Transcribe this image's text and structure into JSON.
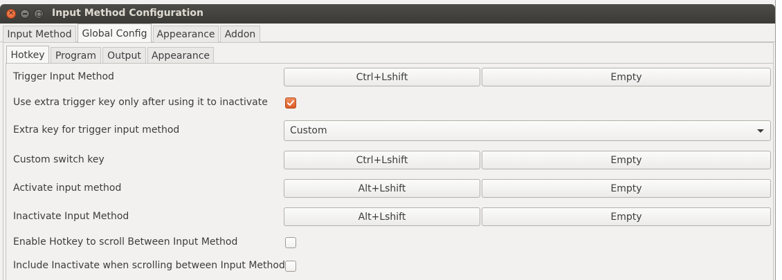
{
  "window": {
    "title": "Input Method Configuration"
  },
  "top_tabs": [
    {
      "label": "Input Method",
      "active": false
    },
    {
      "label": "Global Config",
      "active": true
    },
    {
      "label": "Appearance",
      "active": false
    },
    {
      "label": "Addon",
      "active": false
    }
  ],
  "sub_tabs": [
    {
      "label": "Hotkey",
      "active": true
    },
    {
      "label": "Program",
      "active": false
    },
    {
      "label": "Output",
      "active": false
    },
    {
      "label": "Appearance",
      "active": false
    }
  ],
  "hotkey": {
    "trigger_input_method": {
      "label": "Trigger Input Method",
      "key1": "Ctrl+Lshift",
      "key2": "Empty"
    },
    "extra_trigger_only_after": {
      "label": "Use extra trigger key only after using it to inactivate",
      "checked": true
    },
    "extra_key": {
      "label": "Extra key for trigger input method",
      "value": "Custom"
    },
    "custom_switch_key": {
      "label": "Custom switch key",
      "key1": "Ctrl+Lshift",
      "key2": "Empty"
    },
    "activate_input_method": {
      "label": "Activate input method",
      "key1": "Alt+Lshift",
      "key2": "Empty"
    },
    "inactivate_input_method": {
      "label": "Inactivate Input Method",
      "key1": "Alt+Lshift",
      "key2": "Empty"
    },
    "enable_scroll_hotkey": {
      "label": "Enable Hotkey to scroll Between Input Method",
      "checked": false
    },
    "include_inactivate_scrolling": {
      "label": "Include Inactivate when scrolling between Input Method",
      "checked": false
    }
  },
  "colors": {
    "accent_checkbox": "#dd5a23",
    "titlebar": "#3b3a36",
    "window_bg": "#f2f1f0"
  }
}
